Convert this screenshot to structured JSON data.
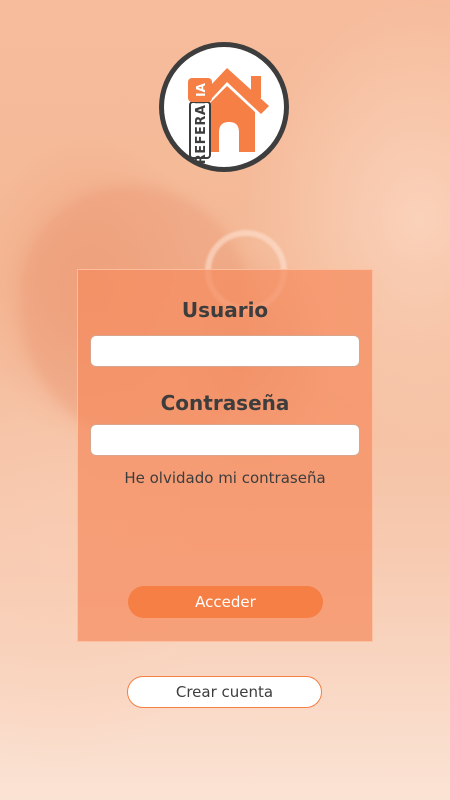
{
  "logo": {
    "text_main": "REFERAL",
    "text_suffix": "IA",
    "icon": "house-icon",
    "colors": {
      "orange": "#f57f45",
      "dark": "#3d3d3d"
    }
  },
  "form": {
    "username_label": "Usuario",
    "username_value": "",
    "username_placeholder": "",
    "password_label": "Contraseña",
    "password_value": "",
    "password_placeholder": "",
    "forgot_password": "He olvidado mi contraseña",
    "submit_label": "Acceder"
  },
  "footer": {
    "create_account_label": "Crear cuenta"
  },
  "colors": {
    "accent": "#f57f45",
    "card": "#f58c5f",
    "text": "#3d3d3d"
  }
}
